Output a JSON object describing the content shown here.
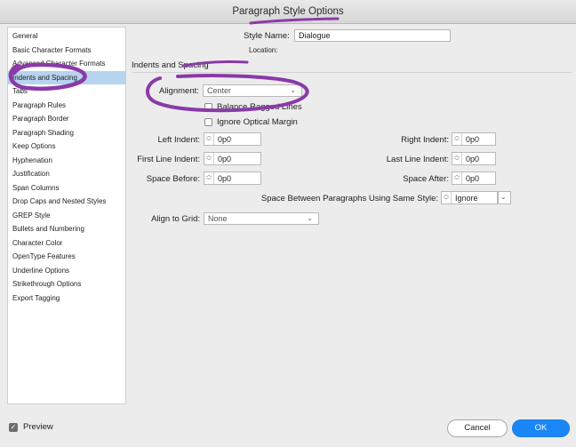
{
  "window": {
    "title": "Paragraph Style Options"
  },
  "sidebar": {
    "items": [
      {
        "label": "General"
      },
      {
        "label": "Basic Character Formats"
      },
      {
        "label": "Advanced Character Formats"
      },
      {
        "label": "Indents and Spacing",
        "selected": true
      },
      {
        "label": "Tabs"
      },
      {
        "label": "Paragraph Rules"
      },
      {
        "label": "Paragraph Border"
      },
      {
        "label": "Paragraph Shading"
      },
      {
        "label": "Keep Options"
      },
      {
        "label": "Hyphenation"
      },
      {
        "label": "Justification"
      },
      {
        "label": "Span Columns"
      },
      {
        "label": "Drop Caps and Nested Styles"
      },
      {
        "label": "GREP Style"
      },
      {
        "label": "Bullets and Numbering"
      },
      {
        "label": "Character Color"
      },
      {
        "label": "OpenType Features"
      },
      {
        "label": "Underline Options"
      },
      {
        "label": "Strikethrough Options"
      },
      {
        "label": "Export Tagging"
      }
    ]
  },
  "header": {
    "style_name_label": "Style Name:",
    "style_name_value": "Dialogue",
    "location_label": "Location:"
  },
  "section": {
    "title": "Indents and Spacing"
  },
  "fields": {
    "alignment_label": "Alignment:",
    "alignment_value": "Center",
    "balance_ragged_lines": "Balance Ragged Lines",
    "ignore_optical_margin": "Ignore Optical Margin",
    "left_indent_label": "Left Indent:",
    "left_indent_value": "0p0",
    "right_indent_label": "Right Indent:",
    "right_indent_value": "0p0",
    "first_line_indent_label": "First Line Indent:",
    "first_line_indent_value": "0p0",
    "last_line_indent_label": "Last Line Indent:",
    "last_line_indent_value": "0p0",
    "space_before_label": "Space Before:",
    "space_before_value": "0p0",
    "space_after_label": "Space After:",
    "space_after_value": "0p0",
    "space_between_label": "Space Between Paragraphs Using Same Style:",
    "space_between_value": "Ignore",
    "align_to_grid_label": "Align to Grid:",
    "align_to_grid_value": "None"
  },
  "footer": {
    "preview_label": "Preview",
    "preview_checked": true,
    "cancel_label": "Cancel",
    "ok_label": "OK"
  },
  "colors": {
    "annotation": "#8a3aa8",
    "accent": "#1a86f7",
    "selection": "#b6d3ef"
  }
}
